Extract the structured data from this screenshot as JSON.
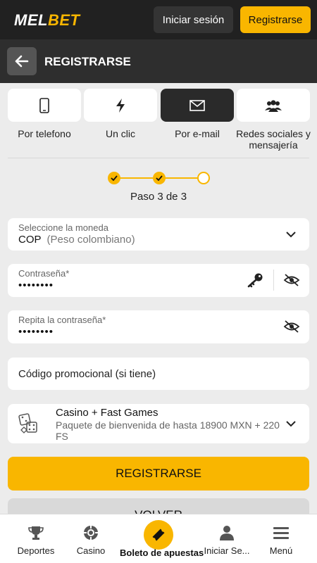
{
  "header": {
    "logo_mel": "MEL",
    "logo_bet": "BET",
    "login_label": "Iniciar sesión",
    "register_label": "Registrarse"
  },
  "subheader": {
    "title": "REGISTRARSE"
  },
  "methods": [
    {
      "label": "Por telefono",
      "icon": "phone-icon",
      "active": false
    },
    {
      "label": "Un clic",
      "icon": "lightning-icon",
      "active": false
    },
    {
      "label": "Por e-mail",
      "icon": "envelope-icon",
      "active": true
    },
    {
      "label": "Redes sociales y mensajería",
      "icon": "users-icon",
      "active": false
    }
  ],
  "steps": {
    "current": 3,
    "total": 3,
    "text": "Paso 3 de 3"
  },
  "form": {
    "currency": {
      "label": "Seleccione la moneda",
      "code": "COP",
      "name": "(Peso colombiano)"
    },
    "password": {
      "label": "Contraseña*",
      "value": "••••••••"
    },
    "repeat_password": {
      "label": "Repita la contraseña*",
      "value": "••••••••"
    },
    "promo_code": {
      "placeholder": "Código promocional (si tiene)"
    },
    "bonus": {
      "title": "Casino + Fast Games",
      "description": "Paquete de bienvenida de hasta 18900 MXN + 220 FS"
    }
  },
  "actions": {
    "submit_label": "REGISTRARSE",
    "back_label": "VOLVER"
  },
  "bottom_nav": [
    {
      "label": "Deportes",
      "icon": "trophy-icon"
    },
    {
      "label": "Casino",
      "icon": "casino-chip-icon"
    },
    {
      "label": "Boleto de apuestas",
      "icon": "ticket-icon"
    },
    {
      "label": "Iniciar Se...",
      "icon": "user-icon"
    },
    {
      "label": "Menú",
      "icon": "menu-icon"
    }
  ],
  "colors": {
    "accent": "#f9b600",
    "dark": "#212121",
    "background": "#ececec"
  }
}
